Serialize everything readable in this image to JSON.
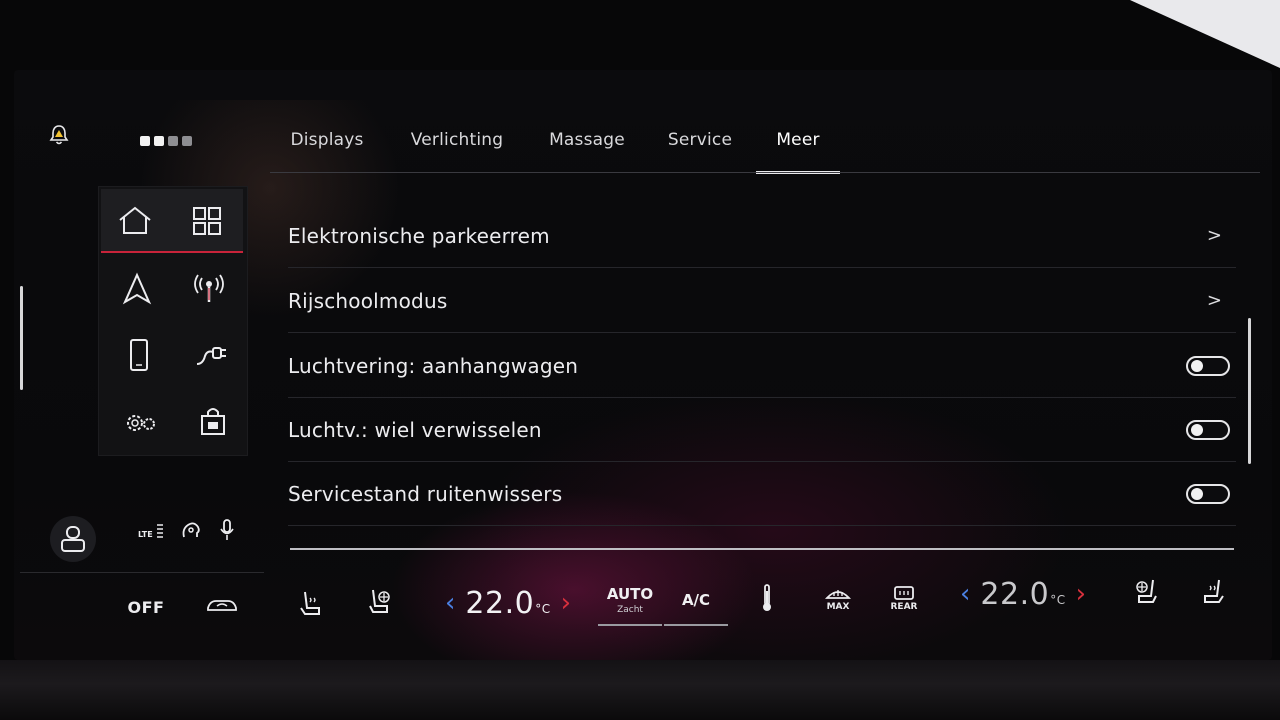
{
  "header": {
    "page_dots": 4,
    "active_dots": 2
  },
  "tabs": [
    {
      "label": "Displays",
      "active": false
    },
    {
      "label": "Verlichting",
      "active": false
    },
    {
      "label": "Massage",
      "active": false
    },
    {
      "label": "Service",
      "active": false
    },
    {
      "label": "Meer",
      "active": true
    }
  ],
  "settings": [
    {
      "label": "Elektronische parkeerrem",
      "control": "chevron",
      "chevron": ">"
    },
    {
      "label": "Rijschoolmodus",
      "control": "chevron",
      "chevron": ">"
    },
    {
      "label": "Luchtvering: aanhangwagen",
      "control": "toggle",
      "on": false
    },
    {
      "label": "Luchtv.: wiel verwisselen",
      "control": "toggle",
      "on": false
    },
    {
      "label": "Servicestand ruitenwissers",
      "control": "toggle",
      "on": false
    }
  ],
  "status": {
    "network": "LTE"
  },
  "climate": {
    "off_label": "OFF",
    "left_temp": "22.0",
    "right_temp": "22.0",
    "temp_unit": "°C",
    "auto_label": "AUTO",
    "auto_sub": "Zacht",
    "ac_label": "A/C",
    "max_label": "MAX",
    "rear_label": "REAR",
    "arrow_left": "‹",
    "arrow_right": "›"
  },
  "colors": {
    "accent_red": "#c8233a",
    "temp_down": "#4a7fe0",
    "temp_up": "#d8303d"
  }
}
